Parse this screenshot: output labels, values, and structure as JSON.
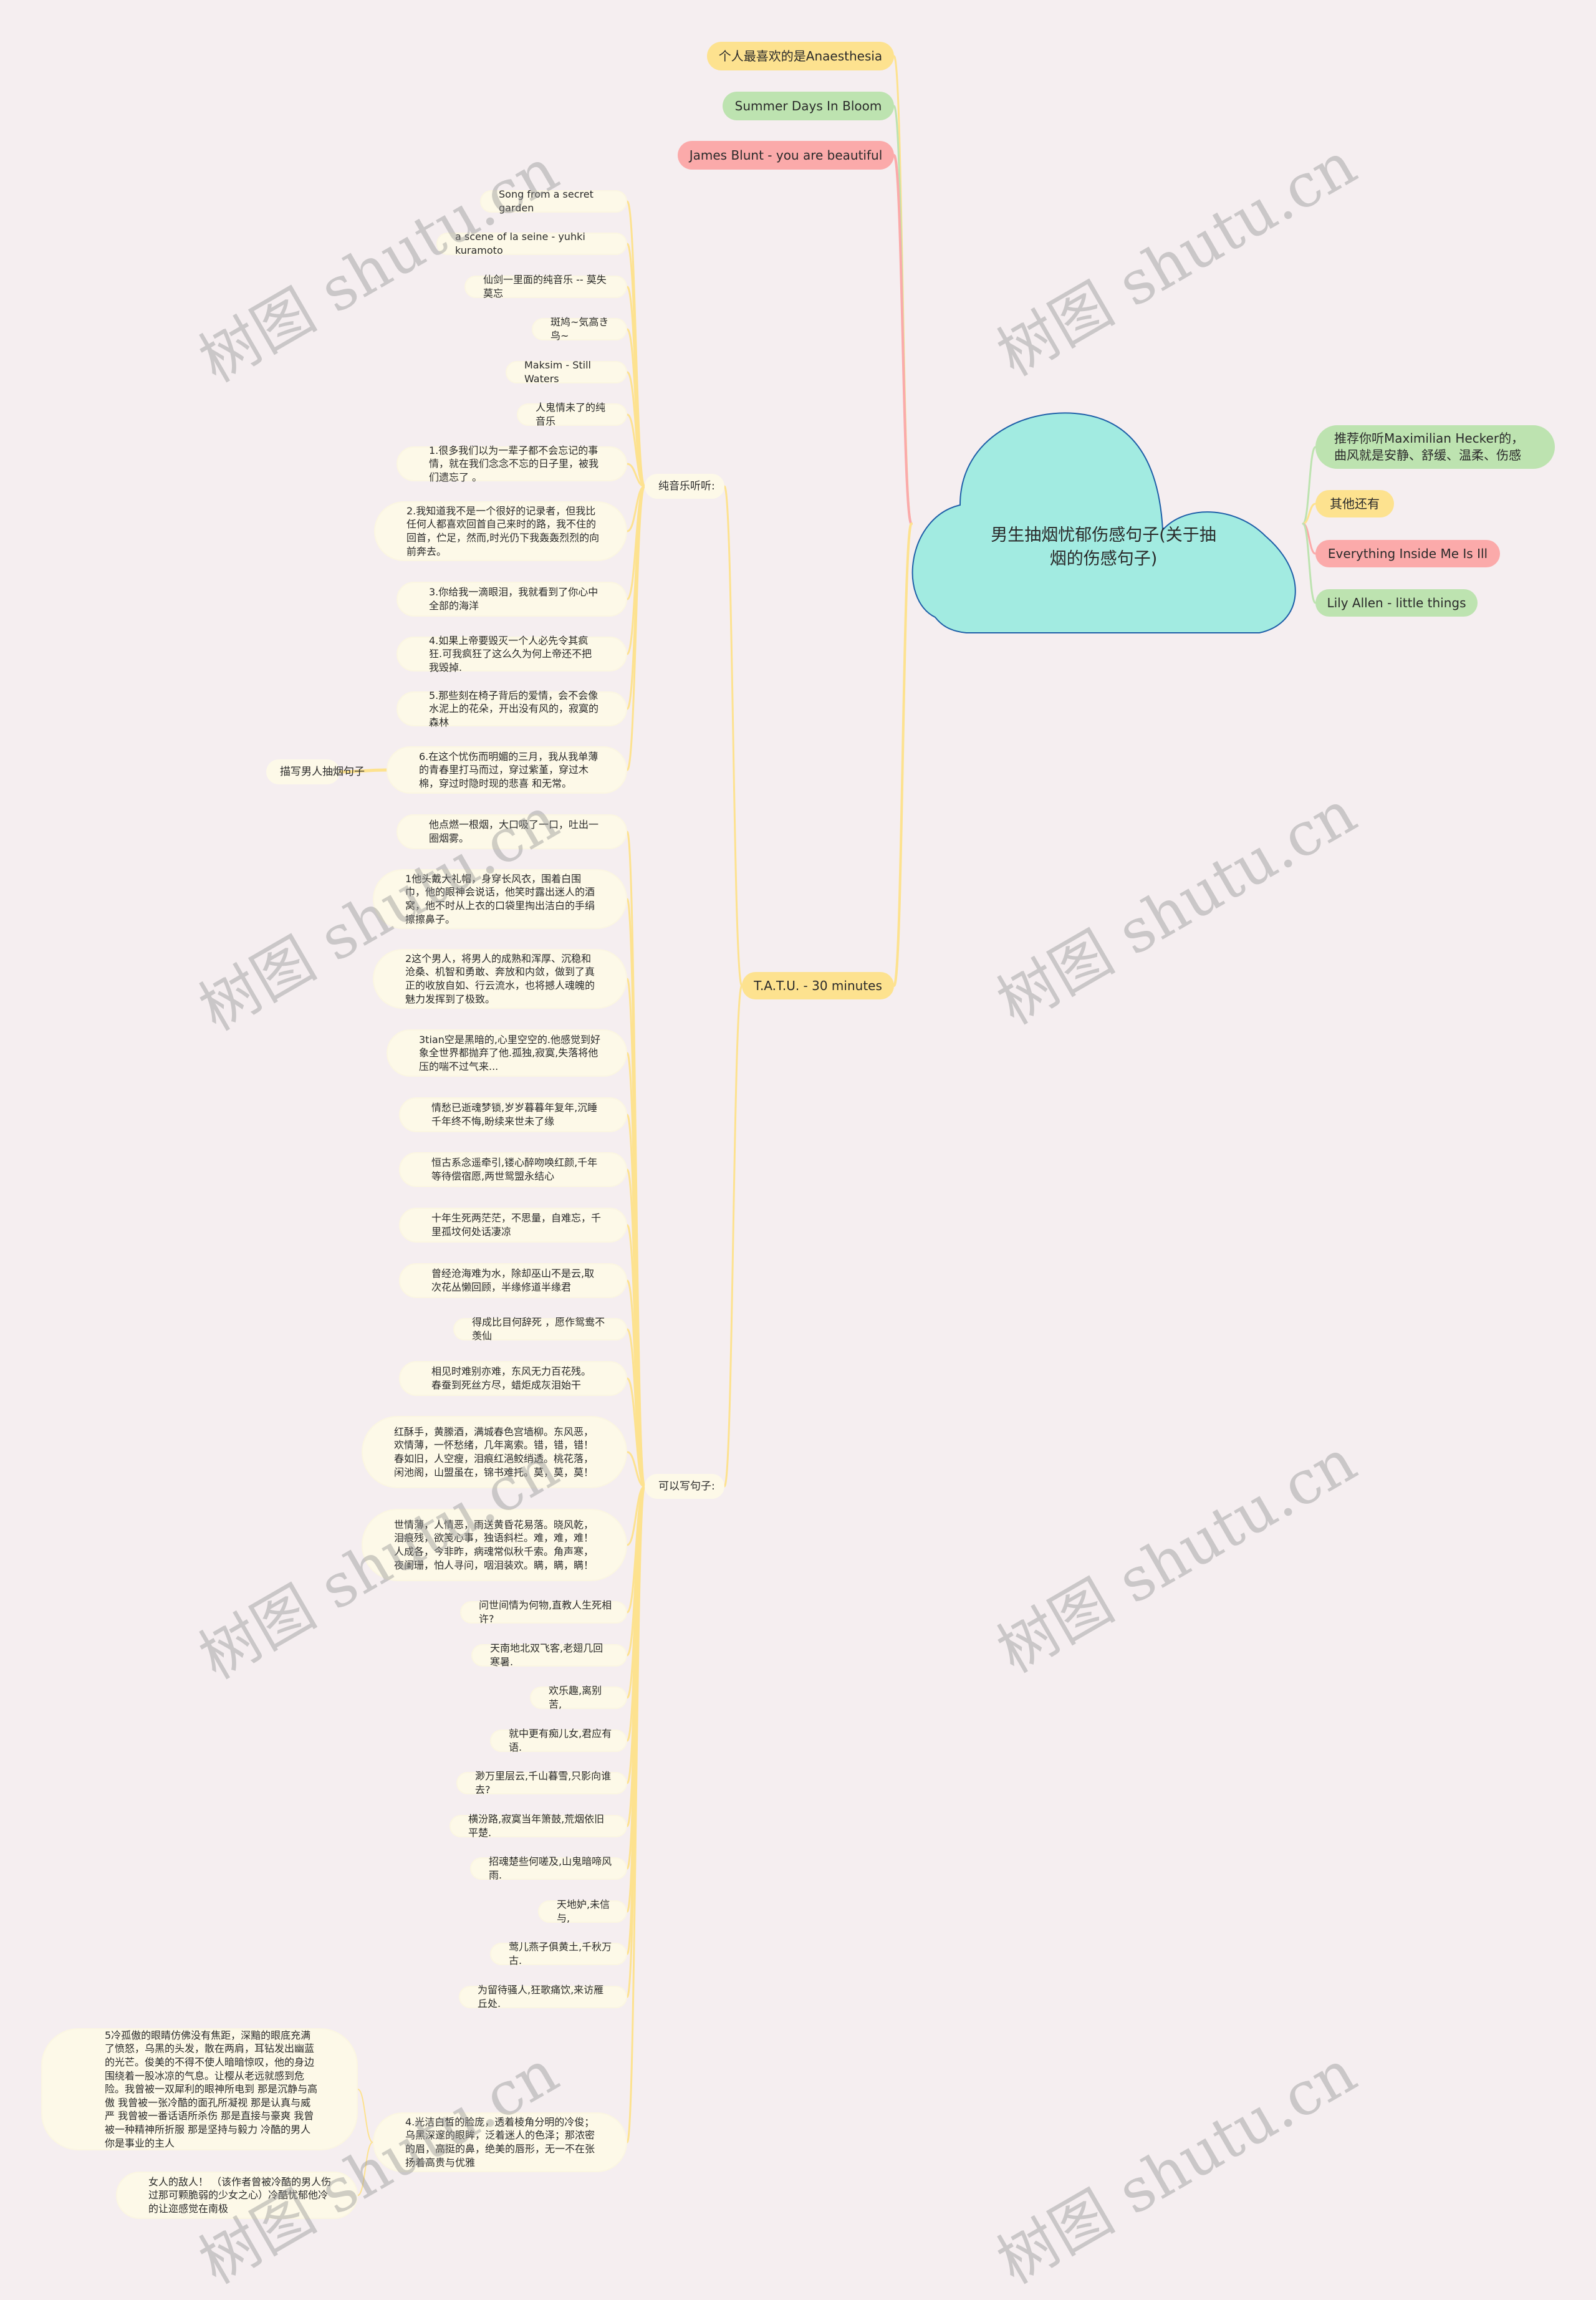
{
  "root": {
    "title": "男生抽烟忧郁伤感句子(关于抽烟的伤感句子)",
    "color": "#a2ebe1",
    "border_color": "#1f5fa8"
  },
  "right_branches": [
    {
      "label": "推荐你听Maximilian Hecker的，曲风就是安静、舒缓、温柔、伤感",
      "color": "#bde3b0"
    },
    {
      "label": "其他还有",
      "color": "#fde28f"
    },
    {
      "label": "Everything Inside Me Is Ill",
      "color": "#fbaaaa"
    },
    {
      "label": "Lily Allen - little things",
      "color": "#bde3b0"
    }
  ],
  "top_branches": [
    {
      "label": "个人最喜欢的是Anaesthesia",
      "color": "#fde28f"
    },
    {
      "label": "Summer Days In Bloom",
      "color": "#bde3b0"
    },
    {
      "label": "James Blunt  - you are beautiful",
      "color": "#fbaaaa"
    }
  ],
  "tatu": {
    "label": "T.A.T.U. - 30 minutes",
    "color": "#fde28f"
  },
  "pure_music": {
    "label": "纯音乐听听:",
    "items": [
      "Song from a secret garden",
      "a scene of la seine - yuhki kuramoto",
      "仙剑一里面的纯音乐 -- 莫失莫忘",
      "斑鸠~気高き鸟~",
      "Maksim - Still Waters",
      "人鬼情未了的纯音乐",
      "1.很多我们以为一辈子都不会忘记的事情，就在我们念念不忘的日子里，被我们遗忘了 。",
      "2.我知道我不是一个很好的记录者，但我比任何人都喜欢回首自己来时的路，我不住的回首，伫足，然而,时光仍下我轰轰烈烈的向前奔去。",
      "3.你给我一滴眼泪，我就看到了你心中全部的海洋",
      "4.如果上帝要毁灭一个人必先令其疯狂.可我疯狂了这么久为何上帝还不把我毁掉.",
      "5.那些刻在椅子背后的爱情，会不会像水泥上的花朵，开出没有风的，寂寞的森林",
      "6.在这个忧伤而明媚的三月，我从我单薄的青春里打马而过，穿过紫堇，穿过木棉，穿过时隐时现的悲喜 和无常。"
    ],
    "extra_child": "描写男人抽烟句子"
  },
  "sentences": {
    "label": "可以写句子:",
    "items": [
      "他点燃一根烟，大口吸了一口，吐出一圈烟雾。",
      "1他头戴大礼帽，身穿长风衣，围着白围巾，他的眼神会说话，他笑时露出迷人的酒窝，他不时从上衣的口袋里掏出洁白的手绢擦擦鼻子。",
      "2这个男人，将男人的成熟和浑厚、沉稳和沧桑、机智和勇敢、奔放和内敛，做到了真正的收放自如、行云流水，也将撼人魂魄的魅力发挥到了极致。",
      "3tian空是黑暗的,心里空空的.他感觉到好象全世界都抛弃了他.孤独,寂寞,失落将他压的喘不过气来...",
      "情愁已逝魂梦锁,岁岁暮暮年复年,沉睡千年终不悔,盼续来世未了缘",
      "恒古系念遥牵引,镂心醉吻唤红颜,千年等待偿宿愿,两世鸳盟永结心",
      "十年生死两茫茫，不思量，自难忘，千里孤坟何处话凄凉",
      "曾经沧海难为水，除却巫山不是云,取次花丛懒回顾，半缘修道半缘君",
      "得成比目何辞死 ，愿作鸳鸯不羡仙",
      "相见时难别亦难，东风无力百花残。 春蚕到死丝方尽，蜡炬成灰泪始干",
      "红酥手，黄縢酒，满城春色宫墙柳。东风恶，欢情薄，一怀愁绪，几年离索。错，错，错！春如旧，人空瘦，泪痕红浥鲛绡透。桃花落，闲池阁，山盟虽在，锦书难托。莫，莫，莫！",
      "世情薄，人情恶，雨送黄昏花易落。晓风乾，泪痕残，欲笺心事，独语斜栏。难，难，难！人成各，今非昨，病魂常似秋千索。角声寒，夜阑珊，怕人寻问，咽泪装欢。瞒，瞒，瞒！",
      "问世间情为何物,直教人生死相许?",
      "天南地北双飞客,老翅几回寒暑.",
      "欢乐趣,离别苦,",
      "就中更有痴儿女,君应有语.",
      "渺万里层云,千山暮雪,只影向谁去?",
      "横汾路,寂寞当年箫鼓,荒烟依旧平楚.",
      "招魂楚些何嗟及,山鬼暗啼风雨.",
      "天地妒,未信与,",
      "莺儿燕子俱黄土,千秋万古.",
      "为留待骚人,狂歌痛饮,来访雁丘处.",
      "4.光洁白皙的脸庞，透着棱角分明的冷俊；乌黑深邃的眼眸，泛着迷人的色泽；那浓密的眉，高挺的鼻，绝美的唇形，无一不在张扬着高贵与优雅"
    ],
    "sub_items": [
      "5冷孤傲的眼睛仿佛没有焦距，深黯的眼底充满了愤怒，乌黑的头发，散在两肩，耳钻发出幽蓝的光芒。俊美的不得不使人暗暗惊叹，他的身边围绕着一股冰凉的气息。让樱从老远就感到危险。我曾被一双犀利的眼神所电到 那是沉静与高傲 我曾被一张冷酷的面孔所凝视 那是认真与威严 我曾被一番话语所杀伤 那是直接与豪爽 我曾被一种精神所折服 那是坚持与毅力 冷酷的男人 你是事业的主人",
      "女人的敌人！ （该作者曾被冷酷的男人伤过那可颗脆弱的少女之心）冷酷忧郁他冷的让迩感觉在南极"
    ]
  },
  "watermark": "树图 shutu.cn",
  "colors": {
    "background": "#f5eef0",
    "leaf": "#fdf9e8",
    "yellow_line": "#fde28f",
    "green_line": "#bde3b0",
    "red_line": "#fbaaaa"
  }
}
